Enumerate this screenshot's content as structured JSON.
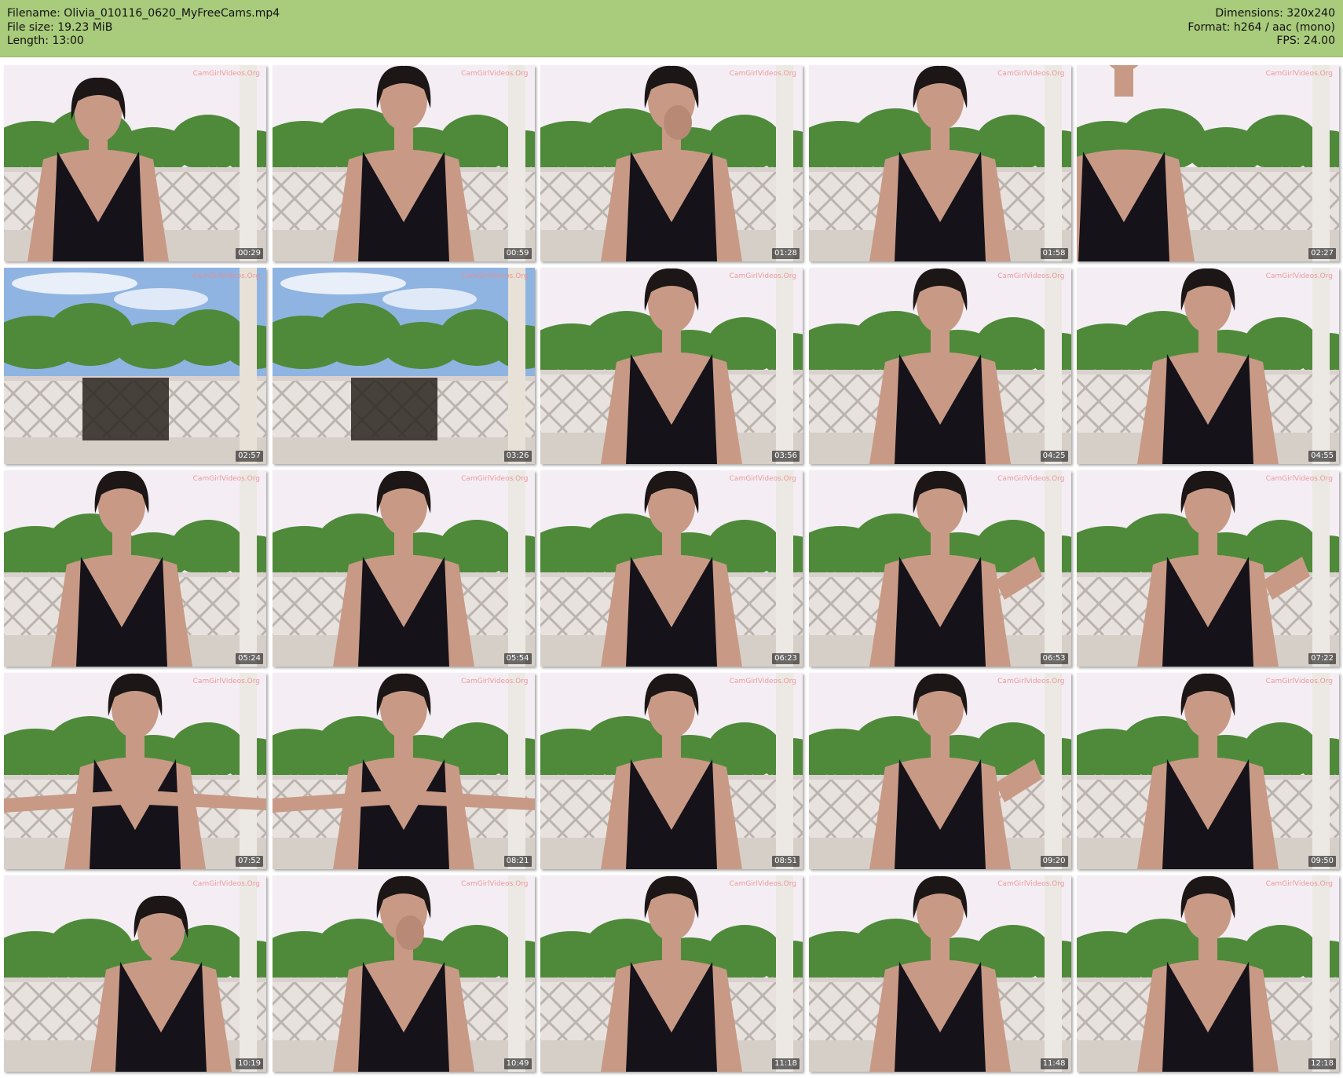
{
  "header": {
    "filename": "Filename: Olivia_010116_0620_MyFreeCams.mp4",
    "filesize": "File size: 19.23 MiB",
    "length": "Length: 13:00",
    "dimensions": "Dimensions: 320x240",
    "format": "Format: h264 / aac (mono)",
    "fps": "FPS: 24.00"
  },
  "watermark": "CamGirlVideos.Org",
  "colors": {
    "header_bg": "#a9cb7c",
    "sky": "#f4eef4",
    "blue_sky": "#8fb4e2",
    "foliage": "#4f8a3a",
    "railing": "#e8e2df",
    "dress": "#15121a",
    "skin": "#c89a86"
  },
  "thumbnails": [
    {
      "time": "00:29",
      "scene": "person-left-head-down"
    },
    {
      "time": "00:59",
      "scene": "person-smiling"
    },
    {
      "time": "01:28",
      "scene": "person-hand-face"
    },
    {
      "time": "01:58",
      "scene": "person-center"
    },
    {
      "time": "02:27",
      "scene": "person-leaning-out"
    },
    {
      "time": "02:57",
      "scene": "empty-blue-sky"
    },
    {
      "time": "03:26",
      "scene": "empty-blue-sky"
    },
    {
      "time": "03:56",
      "scene": "person-smiling"
    },
    {
      "time": "04:25",
      "scene": "person-center"
    },
    {
      "time": "04:55",
      "scene": "person-center"
    },
    {
      "time": "05:24",
      "scene": "person-left"
    },
    {
      "time": "05:54",
      "scene": "person-center"
    },
    {
      "time": "06:23",
      "scene": "person-center"
    },
    {
      "time": "06:53",
      "scene": "person-hand-raised"
    },
    {
      "time": "07:22",
      "scene": "person-arm-raised"
    },
    {
      "time": "07:52",
      "scene": "person-heart-hands"
    },
    {
      "time": "08:21",
      "scene": "person-heart-hands"
    },
    {
      "time": "08:51",
      "scene": "person-center"
    },
    {
      "time": "09:20",
      "scene": "person-waving"
    },
    {
      "time": "09:50",
      "scene": "person-center"
    },
    {
      "time": "10:19",
      "scene": "person-profile"
    },
    {
      "time": "10:49",
      "scene": "person-hand-face"
    },
    {
      "time": "11:18",
      "scene": "person-center"
    },
    {
      "time": "11:48",
      "scene": "person-center"
    },
    {
      "time": "12:18",
      "scene": "person-center"
    }
  ]
}
